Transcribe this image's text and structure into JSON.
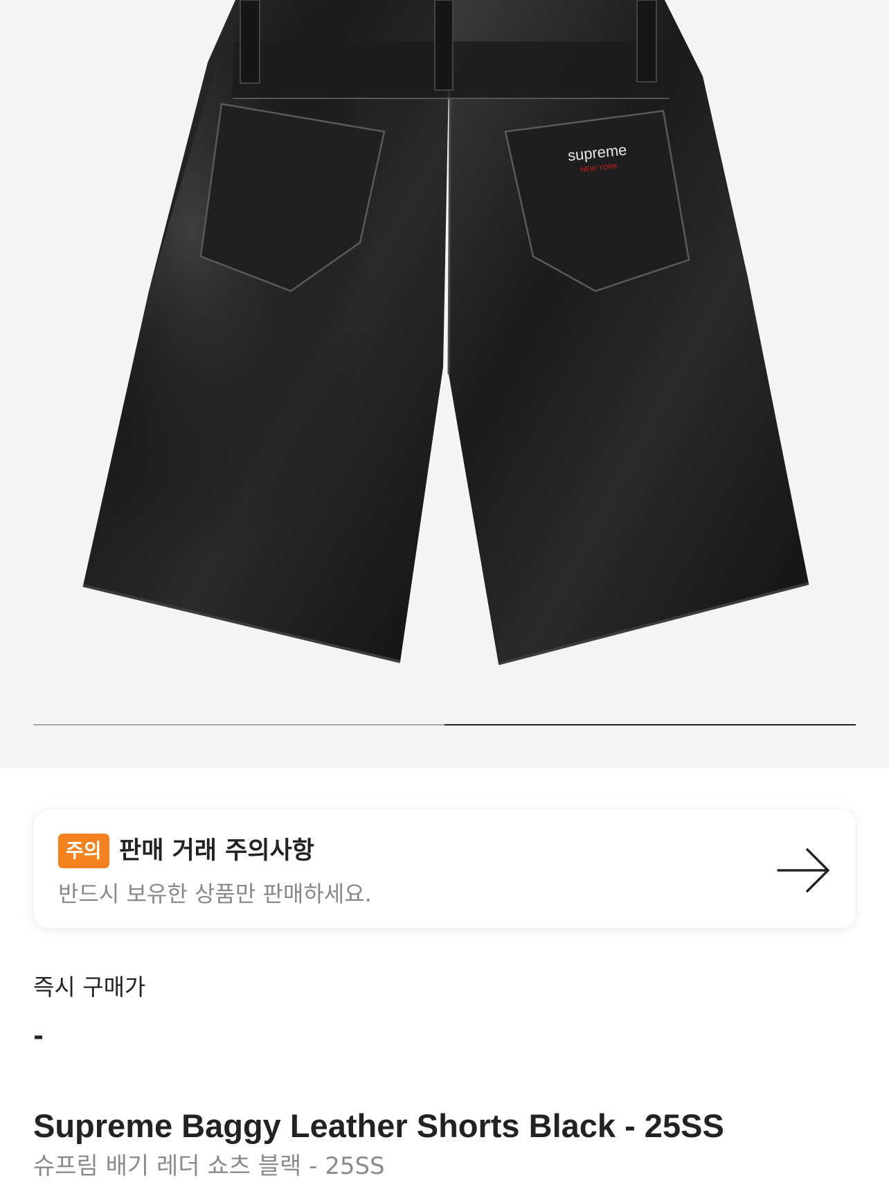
{
  "gallery": {
    "image_alt": "Supreme Baggy Leather Shorts Black back view",
    "brand_tag": "supreme",
    "brand_tag_sub": "NEW YORK",
    "progress": {
      "current_page": 2,
      "total_pages": 2
    }
  },
  "notice": {
    "badge": "주의",
    "title": "판매 거래 주의사항",
    "description": "반드시 보유한 상품만 판매하세요.",
    "icon": "arrow-right-icon",
    "badge_color": "#f3821e"
  },
  "price": {
    "label": "즉시 구매가",
    "value": "-"
  },
  "product": {
    "name_en": "Supreme Baggy Leather Shorts Black - 25SS",
    "name_ko": "슈프림 배기 레더 쇼츠 블랙 - 25SS"
  }
}
